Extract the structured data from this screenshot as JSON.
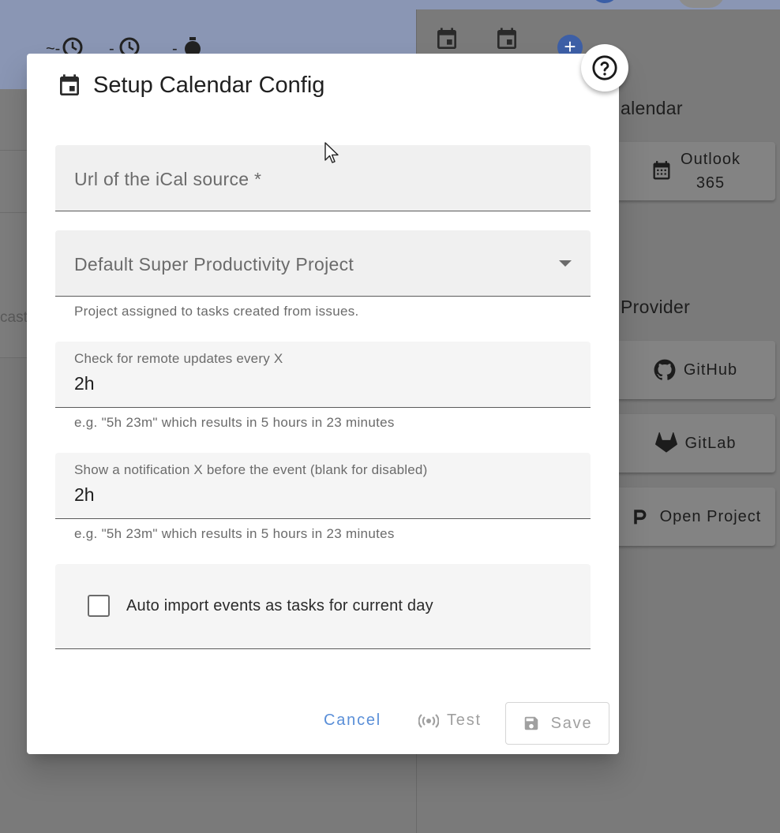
{
  "background": {
    "left_snippet": "cast",
    "headings": {
      "calendar": "alendar",
      "provider": "Provider"
    },
    "providers": {
      "outlook_line1": "Outlook",
      "outlook_line2": "365",
      "github": "GitHub",
      "gitlab": "GitLab",
      "open_project": "Open Project"
    },
    "add_symbol": "+"
  },
  "dialog": {
    "title": "Setup Calendar Config",
    "url_field": {
      "placeholder": "Url of the iCal source *",
      "value": ""
    },
    "project_field": {
      "placeholder": "Default Super Productivity Project",
      "hint": "Project assigned to tasks created from issues."
    },
    "update_field": {
      "label": "Check for remote updates every X",
      "value": "2h",
      "hint": "e.g. \"5h 23m\" which results in 5 hours in 23 minutes"
    },
    "notification_field": {
      "label": "Show a notification X before the event (blank for disabled)",
      "value": "2h",
      "hint": "e.g. \"5h 23m\" which results in 5 hours in 23 minutes"
    },
    "auto_import": {
      "label": "Auto import events as tasks for current day",
      "checked": false
    },
    "actions": {
      "cancel": "Cancel",
      "test": "Test",
      "save": "Save"
    }
  },
  "colors": {
    "accent": "#5a8fd8",
    "disabled": "#a0a0a0"
  }
}
